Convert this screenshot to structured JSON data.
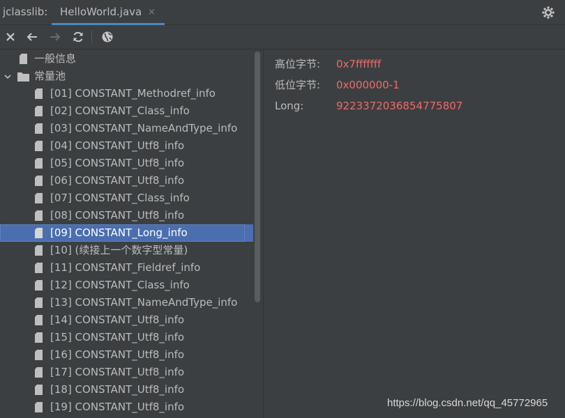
{
  "tabbar": {
    "tool_title": "jclasslib:",
    "active_tab": "HelloWorld.java",
    "close_glyph": "×",
    "settings_icon": "gear-icon"
  },
  "toolbar": {
    "icons": [
      "close-icon",
      "back-arrow-icon",
      "forward-arrow-icon",
      "refresh-icon",
      "browser-icon"
    ]
  },
  "tree": {
    "general": "一般信息",
    "constant_pool": "常量池",
    "items": [
      "[01] CONSTANT_Methodref_info",
      "[02] CONSTANT_Class_info",
      "[03] CONSTANT_NameAndType_info",
      "[04] CONSTANT_Utf8_info",
      "[05] CONSTANT_Utf8_info",
      "[06] CONSTANT_Utf8_info",
      "[07] CONSTANT_Class_info",
      "[08] CONSTANT_Utf8_info",
      "[09] CONSTANT_Long_info",
      "[10] (续接上一个数字型常量)",
      "[11] CONSTANT_Fieldref_info",
      "[12] CONSTANT_Class_info",
      "[13] CONSTANT_NameAndType_info",
      "[14] CONSTANT_Utf8_info",
      "[15] CONSTANT_Utf8_info",
      "[16] CONSTANT_Utf8_info",
      "[17] CONSTANT_Utf8_info",
      "[18] CONSTANT_Utf8_info",
      "[19] CONSTANT_Utf8_info"
    ],
    "selected_index": 8
  },
  "detail": {
    "high_label": "高位字节:",
    "high_value": "0x7fffffff",
    "low_label": "低位字节:",
    "low_value": "0x000000-1",
    "long_label": "Long:",
    "long_value": "9223372036854775807"
  },
  "colors": {
    "value": "#f06a6a",
    "selection": "#4b6eaf",
    "accent": "#4a88c7"
  },
  "watermark": "https://blog.csdn.net/qq_45772965"
}
